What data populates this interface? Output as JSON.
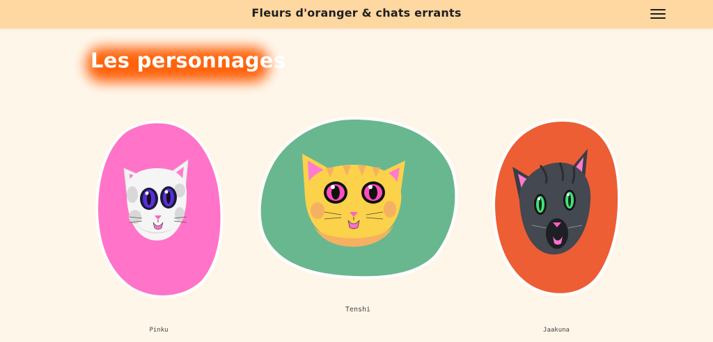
{
  "header": {
    "title": "Fleurs d'oranger & chats errants",
    "menu_icon": "hamburger-menu-icon"
  },
  "page": {
    "heading": "Les personnages"
  },
  "colors": {
    "topbar": "#ffd7a1",
    "background": "#fff6ea",
    "heading_glow": "#ff5b00",
    "pinku_blob": "#ff73c8",
    "tenshi_blob": "#69b78f",
    "jaakuna_blob": "#ed5e34"
  },
  "characters": [
    {
      "name": "Pinku",
      "icon": "white-cat-face-icon"
    },
    {
      "name": "Tenshi",
      "icon": "orange-cat-face-icon"
    },
    {
      "name": "Jaakuna",
      "icon": "dark-grey-cat-face-icon"
    }
  ]
}
